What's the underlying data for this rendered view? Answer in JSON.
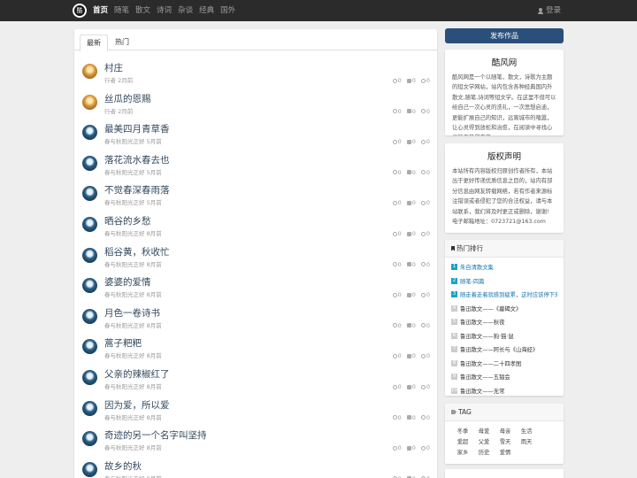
{
  "nav": {
    "logo_text": "酷",
    "links": [
      "首页",
      "随笔",
      "散文",
      "诗词",
      "杂谈",
      "经典",
      "国外"
    ],
    "login": "登录"
  },
  "tabs": [
    "最新",
    "热门"
  ],
  "posts": [
    {
      "title": "村庄",
      "author": "行者",
      "time": "2月前",
      "comments": "0",
      "likes": "0",
      "views": "0",
      "avatar": "warm"
    },
    {
      "title": "丝瓜的恩赐",
      "author": "行者",
      "time": "2月前",
      "comments": "0",
      "likes": "0",
      "views": "0",
      "avatar": "warm"
    },
    {
      "title": "最美四月青草香",
      "author": "春与秋阳光正好",
      "time": "5月前",
      "comments": "0",
      "likes": "0",
      "views": "0",
      "avatar": "cool"
    },
    {
      "title": "落花流水春去也",
      "author": "春与秋阳光正好",
      "time": "5月前",
      "comments": "0",
      "likes": "0",
      "views": "0",
      "avatar": "cool"
    },
    {
      "title": "不觉春深春雨落",
      "author": "春与秋阳光正好",
      "time": "5月前",
      "comments": "0",
      "likes": "0",
      "views": "0",
      "avatar": "cool"
    },
    {
      "title": "晒谷的乡愁",
      "author": "春与秋阳光正好",
      "time": "8月前",
      "comments": "0",
      "likes": "0",
      "views": "0",
      "avatar": "cool"
    },
    {
      "title": "稻谷黄，秋收忙",
      "author": "春与秋阳光正好",
      "time": "8月前",
      "comments": "0",
      "likes": "0",
      "views": "0",
      "avatar": "cool"
    },
    {
      "title": "婆婆的爱情",
      "author": "春与秋阳光正好",
      "time": "8月前",
      "comments": "0",
      "likes": "0",
      "views": "0",
      "avatar": "cool"
    },
    {
      "title": "月色一卷诗书",
      "author": "春与秋阳光正好",
      "time": "8月前",
      "comments": "0",
      "likes": "0",
      "views": "0",
      "avatar": "cool"
    },
    {
      "title": "蒿子粑粑",
      "author": "春与秋阳光正好",
      "time": "8月前",
      "comments": "0",
      "likes": "0",
      "views": "0",
      "avatar": "cool"
    },
    {
      "title": "父亲的辣椒红了",
      "author": "春与秋阳光正好",
      "time": "8月前",
      "comments": "0",
      "likes": "0",
      "views": "0",
      "avatar": "cool"
    },
    {
      "title": "因为爱，所以爱",
      "author": "春与秋阳光正好",
      "time": "8月前",
      "comments": "0",
      "likes": "0",
      "views": "0",
      "avatar": "cool"
    },
    {
      "title": "奇迹的另一个名字叫坚持",
      "author": "春与秋阳光正好",
      "time": "8月前",
      "comments": "0",
      "likes": "0",
      "views": "0",
      "avatar": "cool"
    },
    {
      "title": "故乡的秋",
      "author": "春与秋阳光正好",
      "time": "8月前",
      "comments": "0",
      "likes": "0",
      "views": "0",
      "avatar": "cool"
    }
  ],
  "sidebar": {
    "publish": "发布作品",
    "about_title": "酷风网",
    "about_text": "酷风网是一个以随笔，散文，诗歌为主题的短文学网站，站内包含各种经典国内外散文,随笔,诗词等短文学。在这里不但可以给自己一次心灵的洗礼，一次思想启迪，更能扩展自己的知识，远离城市的喧嚣，让心灵得到放松和治愈，在阅读中寻找心灵的平静和安宁。",
    "copyright_title": "版权声明",
    "copyright_text": "本站所有内容版权归原创作者所有，本站出于更好传递优质信息之目的，站内有部分信息由网友转载网络，若有作者来源标注错误或者侵犯了您的合法权益，请与本站联系，我们将及时更正或删除，谢谢!",
    "email": "电子邮箱地址：0723721@163.com",
    "hot_title": "热门排行",
    "hot": [
      {
        "rank": "1",
        "title": "朱自清散文集"
      },
      {
        "rank": "2",
        "title": "随笔-四篇"
      },
      {
        "rank": "3",
        "title": "随走着走着就感到疲累，这时应该停下来"
      },
      {
        "rank": "4",
        "title": "鲁迅散文——《墓碣文》"
      },
      {
        "rank": "5",
        "title": "鲁迅散文——秋夜"
      },
      {
        "rank": "6",
        "title": "鲁迅散文——狗·猫·鼠"
      },
      {
        "rank": "7",
        "title": "鲁迅散文——阿长与《山海经》"
      },
      {
        "rank": "8",
        "title": "鲁迅散文——二十四孝图"
      },
      {
        "rank": "9",
        "title": "鲁迅散文——五猖会"
      },
      {
        "rank": "10",
        "title": "鲁迅散文——无常"
      }
    ],
    "tag_title": "TAG",
    "tags": [
      "冬季",
      "母爱",
      "母亲",
      "生活",
      "爱超",
      "父爱",
      "雪天",
      "雨天",
      "家乡",
      "历史",
      "爱情"
    ]
  },
  "colors": {
    "nav_bg": "#2b2b2b",
    "accent": "#2a4f7a",
    "rank_top": "#1ba1c8",
    "title": "#34495e"
  }
}
